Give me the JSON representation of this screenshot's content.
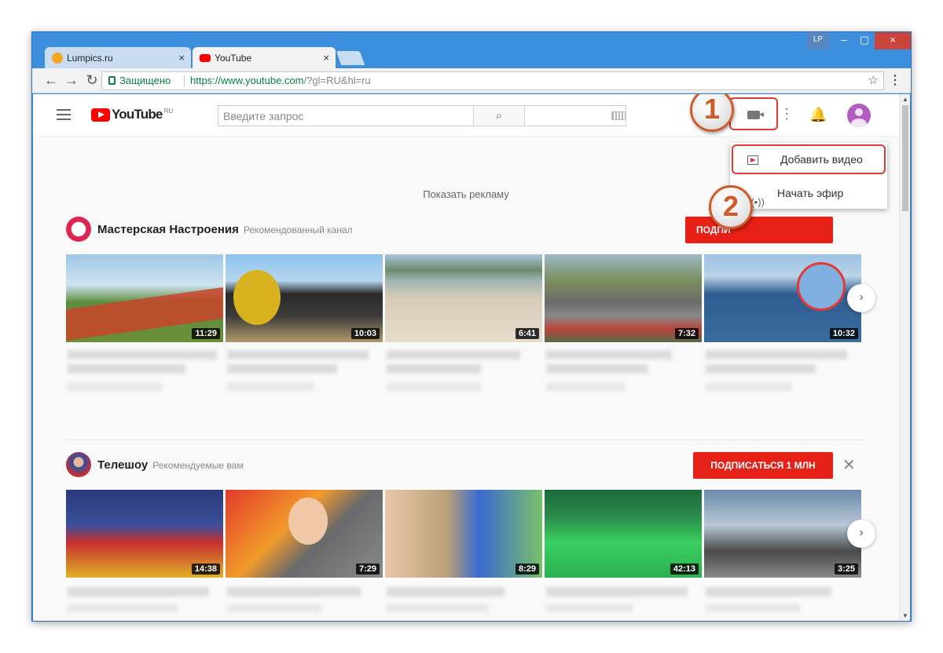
{
  "browser": {
    "tabs": [
      {
        "label": "Lumpics.ru",
        "icon": "lumpics-favicon-icon",
        "close": "×"
      },
      {
        "label": "YouTube",
        "icon": "youtube-favicon-icon",
        "close": "×"
      }
    ],
    "profile_badge": "LP",
    "win_min": "–",
    "win_max": "▢",
    "win_close": "×",
    "nav": {
      "back": "←",
      "forward": "→",
      "reload": "↻"
    },
    "secure_label": "Защищено",
    "url_main": "https://www.youtube.com",
    "url_rest": "/?gl=RU&hl=ru",
    "star": "☆",
    "menu": "⋮"
  },
  "youtube": {
    "logo_text": "YouTube",
    "logo_region": "RU",
    "search_placeholder": "Введите запрос",
    "search_icon": "⌕",
    "apps_icon": "⋮",
    "bell_icon": "🔔",
    "upload_menu": {
      "items": [
        {
          "label": "Добавить видео",
          "icon": "upload-video-icon"
        },
        {
          "label": "Начать эфир",
          "icon": "live-stream-icon"
        }
      ]
    },
    "annotations": [
      "1",
      "2"
    ],
    "ad_link": "Показать рекламу",
    "shelves": [
      {
        "channel": "Мастерская Настроения",
        "subtitle": "Рекомендованный канал",
        "subscribe_label": "ПОДПИ",
        "videos": [
          {
            "duration": "11:29"
          },
          {
            "duration": "10:03"
          },
          {
            "duration": "6:41"
          },
          {
            "duration": "7:32"
          },
          {
            "duration": "10:32"
          }
        ]
      },
      {
        "channel": "Телешоу",
        "subtitle": "Рекомендуемые вам",
        "subscribe_label": "ПОДПИСАТЬСЯ 1 МЛН",
        "dismiss": "✕",
        "videos": [
          {
            "duration": "14:38"
          },
          {
            "duration": "7:29"
          },
          {
            "duration": "8:29"
          },
          {
            "duration": "42:13"
          },
          {
            "duration": "3:25"
          }
        ]
      }
    ],
    "next_arrow": "›"
  },
  "colors": {
    "window_frame": "#3c8fdc",
    "youtube_red": "#ff0000",
    "subscribe_red": "#e62117",
    "annotation_border": "#e53935",
    "secure_green": "#0b8043"
  }
}
